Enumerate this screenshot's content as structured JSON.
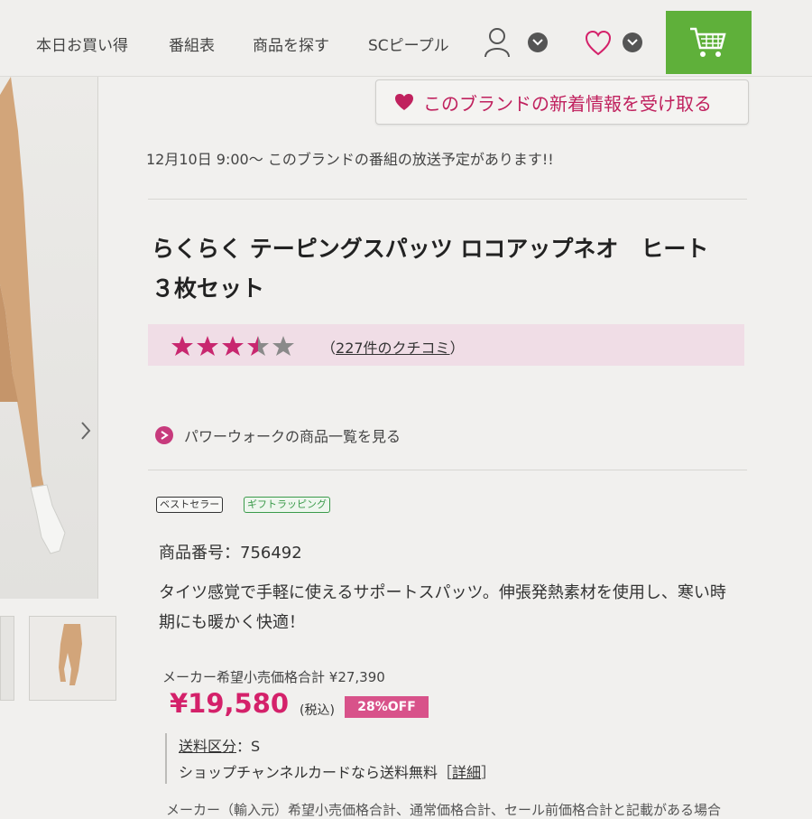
{
  "nav": {
    "items": [
      "本日お買い得",
      "番組表",
      "商品を探す",
      "SCピープル"
    ],
    "cart_color": "#5fb03a"
  },
  "follow_brand": {
    "label": "このブランドの新着情報を受け取る",
    "color": "#c0215e"
  },
  "notice": "12月10日 9:00～ このブランドの番組の放送予定があります!!",
  "product": {
    "title_line1": "らくらく テーピングスパッツ ロコアップネオ　ヒート",
    "title_line2": "３枚セット",
    "rating": 3.5,
    "rating_max": 5,
    "reviews_open": "（",
    "reviews_link": "227件のクチコミ",
    "reviews_close": "）",
    "brand_link": "パワーウォークの商品一覧を見る",
    "badges": [
      "ベストセラー",
      "ギフトラッピング"
    ],
    "product_no": "商品番号：756492",
    "description": "タイツ感覚で手軽に使えるサポートスパッツ。伸張発熱素材を使用し、寒い時期にも暖かく快適！",
    "msrp": "メーカー希望小売価格合計 ¥27,390",
    "price": "¥19,580",
    "tax_note": "(税込)",
    "discount": "28%OFF",
    "price_color": "#d4216a"
  },
  "shipping": {
    "class_label": "送料区分",
    "class_value": "：S",
    "free_text": "ショップチャンネルカードなら送料無料［",
    "detail_link": "詳細",
    "free_close": "］"
  },
  "footnote": "メーカー（輸入元）希望小売価格合計、通常価格合計、セール前価格合計と記載がある場合"
}
